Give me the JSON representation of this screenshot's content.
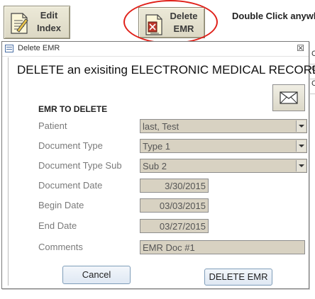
{
  "toolbar": {
    "edit_index": {
      "line1": "Edit",
      "line2": "Index"
    },
    "delete_emr": {
      "line1": "Delete",
      "line2": "EMR"
    },
    "hint": "Double Click anywl"
  },
  "side_strip": [
    "C",
    "C",
    "C"
  ],
  "dialog": {
    "title": "Delete EMR",
    "close_glyph": "☒",
    "heading": "DELETE an exisiting ELECTRONIC MEDICAL RECORD",
    "section_label": "EMR TO DELETE",
    "fields": {
      "patient": {
        "label": "Patient",
        "value": "last, Test"
      },
      "document_type": {
        "label": "Document Type",
        "value": "Type 1"
      },
      "document_type_sub": {
        "label": "Document Type Sub",
        "value": "Sub 2"
      },
      "document_date": {
        "label": "Document Date",
        "value": "3/30/2015"
      },
      "begin_date": {
        "label": "Begin Date",
        "value": "03/03/2015"
      },
      "end_date": {
        "label": "End Date",
        "value": "03/27/2015"
      },
      "comments": {
        "label": "Comments",
        "value": "EMR Doc #1"
      }
    },
    "buttons": {
      "cancel": "Cancel",
      "delete": "DELETE EMR"
    }
  },
  "colors": {
    "highlight_circle": "#e0211a",
    "field_bg": "#d8d2c2",
    "button_border": "#7f9db9"
  }
}
